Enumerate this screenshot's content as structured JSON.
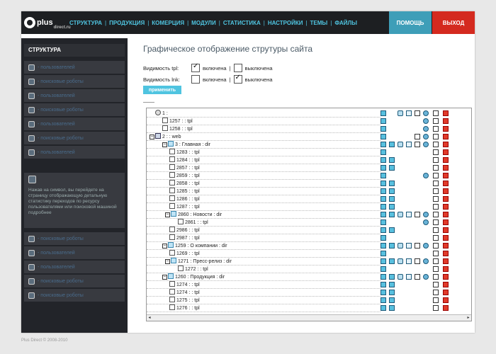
{
  "logo": {
    "text": "plus",
    "sub": "direct.ru"
  },
  "nav": {
    "items": [
      "СТРУКТУРА",
      "ПРОДУКЦИЯ",
      "КОМЕРЦИЯ",
      "МОДУЛИ",
      "СТАТИСТИКА",
      "НАСТРОЙКИ",
      "ТЕМЫ",
      "ФАЙЛЫ"
    ]
  },
  "header": {
    "help_label": "ПОМОЩЬ",
    "exit_label": "ВЫХОД"
  },
  "sidebar": {
    "title": "СТРУКТУРА",
    "items": [
      "- пользователей",
      "- поисковые роботы",
      "- пользователей",
      "- поисковые роботы",
      "- пользователей",
      "- поисковые роботы",
      "- пользователей"
    ],
    "note": "Нажав на символ, вы перейдете на страницу отображающую детальную статистику переходов по ресурсу пользователями или поисковой машиной подробнее",
    "items_after": [
      "- поисковые роботы",
      "- пользователей",
      "- пользователей",
      "- поисковые роботы",
      "- поисковые роботы"
    ]
  },
  "main": {
    "title": "Графическое отображение струтуры сайта",
    "visibility_tpl": {
      "label": "Видимость tpl:",
      "on": "включена",
      "off": "выключена",
      "selected": "on"
    },
    "visibility_lnk": {
      "label": "Видимость lnk:",
      "on": "включена",
      "off": "выключена",
      "selected": "off"
    },
    "apply_label": "применить"
  },
  "tree": {
    "rows": [
      {
        "label": "1 :",
        "icon": "root",
        "actions": [
          "add",
          "move",
          "edit",
          "doc",
          "gear",
          "file",
          "del"
        ]
      },
      {
        "label": "1257 : : tpl",
        "icon": "tpl",
        "actions": [
          "add",
          "gear",
          "file",
          "del"
        ]
      },
      {
        "label": "1258 : : tpl",
        "icon": "tpl",
        "actions": [
          "add",
          "gear",
          "file",
          "del"
        ]
      },
      {
        "label": "2 : : web",
        "icon": "web",
        "actions": [
          "add",
          "doc",
          "gear",
          "file",
          "del"
        ]
      },
      {
        "label": "3 : Главная : dir",
        "icon": "dir",
        "actions": [
          "add",
          "add",
          "move",
          "edit",
          "doc",
          "gear",
          "file",
          "del"
        ]
      },
      {
        "label": "1283 : : tpl",
        "icon": "tpl",
        "actions": [
          "add",
          "file",
          "del"
        ]
      },
      {
        "label": "1284 : : tpl",
        "icon": "tpl",
        "actions": [
          "add",
          "add",
          "file",
          "del"
        ]
      },
      {
        "label": "2857 : : tpl",
        "icon": "tpl",
        "actions": [
          "add",
          "add",
          "file",
          "del"
        ]
      },
      {
        "label": "2859 : : tpl",
        "icon": "tpl",
        "actions": [
          "add",
          "gear",
          "file",
          "del"
        ]
      },
      {
        "label": "2858 : : tpl",
        "icon": "tpl",
        "actions": [
          "add",
          "add",
          "file",
          "del"
        ]
      },
      {
        "label": "1285 : : tpl",
        "icon": "tpl",
        "actions": [
          "add",
          "add",
          "file",
          "del"
        ]
      },
      {
        "label": "1286 : : tpl",
        "icon": "tpl",
        "actions": [
          "add",
          "add",
          "file",
          "del"
        ]
      },
      {
        "label": "1287 : : tpl",
        "icon": "tpl",
        "actions": [
          "add",
          "add",
          "file",
          "del"
        ]
      },
      {
        "label": "2860 : Новости : dir",
        "icon": "dir",
        "actions": [
          "add",
          "add",
          "move",
          "edit",
          "doc",
          "gear",
          "file",
          "del"
        ]
      },
      {
        "label": "2861 : : tpl",
        "icon": "tpl",
        "actions": [
          "add",
          "gear",
          "file",
          "del"
        ]
      },
      {
        "label": "2986 : : tpl",
        "icon": "tpl",
        "actions": [
          "add",
          "add",
          "file",
          "del"
        ]
      },
      {
        "label": "2987 : : tpl",
        "icon": "tpl",
        "actions": [
          "add",
          "file",
          "del"
        ]
      },
      {
        "label": "1259 : О компании : dir",
        "icon": "dir",
        "actions": [
          "add",
          "add",
          "move",
          "edit",
          "doc",
          "gear",
          "file",
          "del"
        ]
      },
      {
        "label": "1269 : : tpl",
        "icon": "tpl",
        "actions": [
          "add",
          "file",
          "del"
        ]
      },
      {
        "label": "1271 : Пресс-релиз : dir",
        "icon": "dir",
        "actions": [
          "add",
          "add",
          "move",
          "edit",
          "doc",
          "gear",
          "file",
          "del"
        ]
      },
      {
        "label": "1272 : : tpl",
        "icon": "tpl",
        "actions": [
          "add",
          "file",
          "del"
        ]
      },
      {
        "label": "1260 : Продукция : dir",
        "icon": "dir",
        "actions": [
          "add",
          "add",
          "move",
          "edit",
          "doc",
          "gear",
          "file",
          "del"
        ]
      },
      {
        "label": "1274 : : tpl",
        "icon": "tpl",
        "actions": [
          "add",
          "add",
          "file",
          "del"
        ]
      },
      {
        "label": "1274 : : tpl",
        "icon": "tpl",
        "actions": [
          "add",
          "add",
          "file",
          "del"
        ]
      },
      {
        "label": "1275 : : tpl",
        "icon": "tpl",
        "actions": [
          "add",
          "add",
          "file",
          "del"
        ]
      },
      {
        "label": "1276 : : tpl",
        "icon": "tpl",
        "actions": [
          "add",
          "add",
          "file",
          "del"
        ]
      }
    ]
  },
  "footer": "Plus Direct © 2008-2010 "
}
